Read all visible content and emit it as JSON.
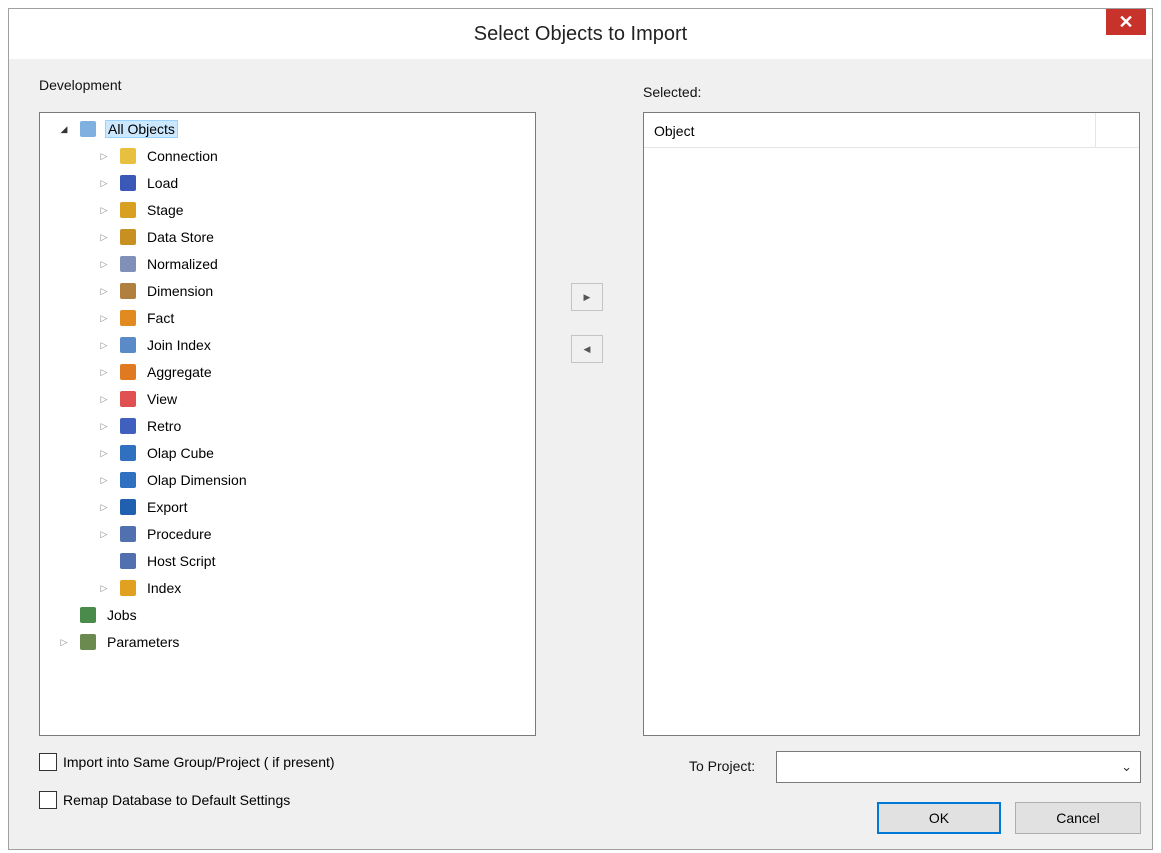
{
  "window": {
    "title": "Select Objects to Import",
    "close_glyph": "✕"
  },
  "source": {
    "label": "Development",
    "tree": [
      {
        "label": "All Objects",
        "icon": "folder-icon",
        "color": "#7fb0e0",
        "level": 0,
        "expander": "open",
        "selected": true
      },
      {
        "label": "Connection",
        "icon": "connection-icon",
        "color": "#e8c040",
        "level": 1,
        "expander": "closed"
      },
      {
        "label": "Load",
        "icon": "load-icon",
        "color": "#3a58b8",
        "level": 1,
        "expander": "closed"
      },
      {
        "label": "Stage",
        "icon": "stage-icon",
        "color": "#d8a020",
        "level": 1,
        "expander": "closed"
      },
      {
        "label": "Data Store",
        "icon": "data-store-icon",
        "color": "#c89020",
        "level": 1,
        "expander": "closed"
      },
      {
        "label": "Normalized",
        "icon": "normalized-icon",
        "color": "#8090b8",
        "level": 1,
        "expander": "closed"
      },
      {
        "label": "Dimension",
        "icon": "dimension-icon",
        "color": "#b08040",
        "level": 1,
        "expander": "closed"
      },
      {
        "label": "Fact",
        "icon": "fact-icon",
        "color": "#e08a20",
        "level": 1,
        "expander": "closed"
      },
      {
        "label": "Join Index",
        "icon": "join-index-icon",
        "color": "#5a8ac8",
        "level": 1,
        "expander": "closed"
      },
      {
        "label": "Aggregate",
        "icon": "aggregate-icon",
        "color": "#e07a20",
        "level": 1,
        "expander": "closed"
      },
      {
        "label": "View",
        "icon": "view-icon",
        "color": "#e05050",
        "level": 1,
        "expander": "closed"
      },
      {
        "label": "Retro",
        "icon": "retro-icon",
        "color": "#4060c0",
        "level": 1,
        "expander": "closed"
      },
      {
        "label": "Olap Cube",
        "icon": "olap-cube-icon",
        "color": "#3070c0",
        "level": 1,
        "expander": "closed"
      },
      {
        "label": "Olap Dimension",
        "icon": "olap-dimension-icon",
        "color": "#3070c0",
        "level": 1,
        "expander": "closed"
      },
      {
        "label": "Export",
        "icon": "export-icon",
        "color": "#2060b0",
        "level": 1,
        "expander": "closed"
      },
      {
        "label": "Procedure",
        "icon": "procedure-icon",
        "color": "#5070b0",
        "level": 1,
        "expander": "closed"
      },
      {
        "label": "Host Script",
        "icon": "host-script-icon",
        "color": "#5070b0",
        "level": 1,
        "expander": "none"
      },
      {
        "label": "Index",
        "icon": "index-icon",
        "color": "#e0a020",
        "level": 1,
        "expander": "closed"
      },
      {
        "label": "Jobs",
        "icon": "jobs-icon",
        "color": "#4a8a4a",
        "level": 0,
        "expander": "none"
      },
      {
        "label": "Parameters",
        "icon": "parameters-icon",
        "color": "#6a8a50",
        "level": 0,
        "expander": "closed"
      }
    ]
  },
  "transfer": {
    "add_glyph": "▶",
    "remove_glyph": "◀"
  },
  "selected": {
    "label": "Selected:",
    "column_header": "Object",
    "items": []
  },
  "options": {
    "same_group_label": "Import into Same Group/Project ( if present)",
    "same_group_checked": false,
    "remap_label": "Remap Database to Default Settings",
    "remap_checked": false
  },
  "to_project": {
    "label": "To Project:",
    "value": "",
    "arrow_glyph": "⌄"
  },
  "buttons": {
    "ok": "OK",
    "cancel": "Cancel"
  }
}
